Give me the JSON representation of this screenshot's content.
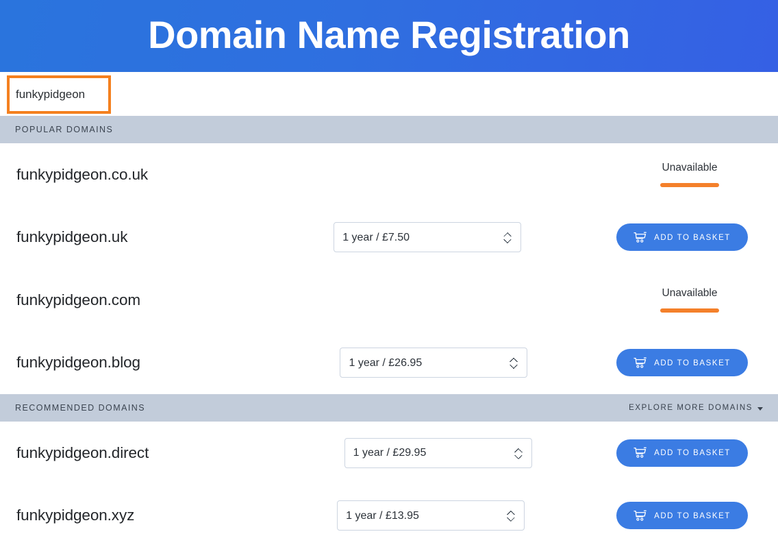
{
  "header": {
    "title": "Domain Name Registration",
    "gradient_from": "#2a74dd",
    "gradient_to": "#3560e4"
  },
  "search": {
    "value": "funkypidgeon",
    "placeholder": "",
    "border_color": "#f4801f"
  },
  "sections": [
    {
      "id": "popular",
      "title": "POPULAR DOMAINS",
      "explore_label": "",
      "has_explore": false,
      "rows": [
        {
          "domain": "funkypidgeon.co.uk",
          "available": false,
          "status": "Unavailable",
          "term": "",
          "action_label": ""
        },
        {
          "domain": "funkypidgeon.uk",
          "available": true,
          "status": "",
          "term": "1 year / £7.50",
          "action_label": "ADD TO BASKET"
        },
        {
          "domain": "funkypidgeon.com",
          "available": false,
          "status": "Unavailable",
          "term": "",
          "action_label": ""
        },
        {
          "domain": "funkypidgeon.blog",
          "available": true,
          "status": "",
          "term": "1 year / £26.95",
          "action_label": "ADD TO BASKET"
        }
      ]
    },
    {
      "id": "recommended",
      "title": "RECOMMENDED DOMAINS",
      "explore_label": "EXPLORE MORE DOMAINS",
      "has_explore": true,
      "rows": [
        {
          "domain": "funkypidgeon.direct",
          "available": true,
          "status": "",
          "term": "1 year / £29.95",
          "action_label": "ADD TO BASKET"
        },
        {
          "domain": "funkypidgeon.xyz",
          "available": true,
          "status": "",
          "term": "1 year / £13.95",
          "action_label": "ADD TO BASKET"
        }
      ]
    }
  ],
  "colors": {
    "section_bar": "#c2ccda",
    "button_blue": "#3b7ce3",
    "accent_orange": "#f4802a",
    "text_dark": "#23262a"
  },
  "icons": {
    "cart": "shopping-cart-icon",
    "caret": "chevron-down-icon"
  }
}
